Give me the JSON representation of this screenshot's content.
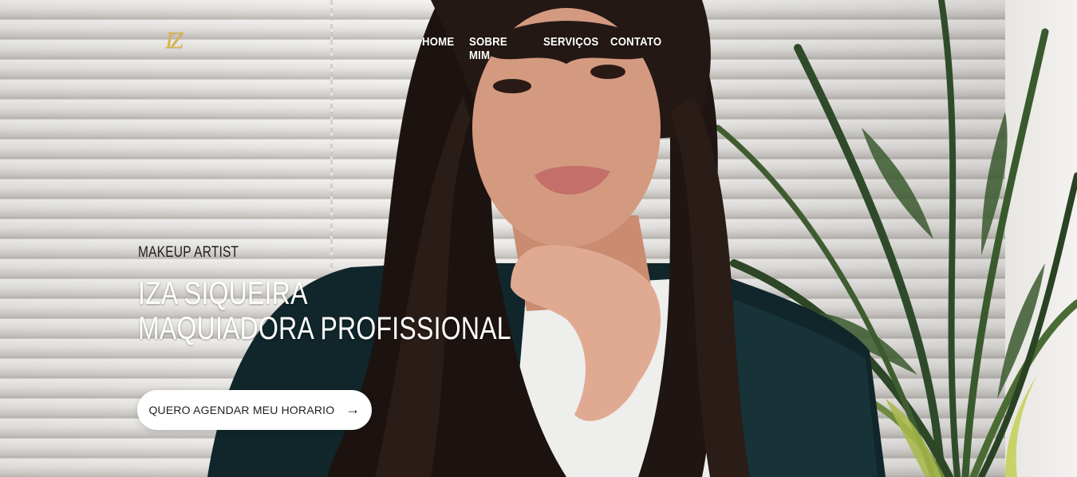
{
  "header": {
    "logo_text": "IZ",
    "nav": [
      {
        "label": "HOME"
      },
      {
        "label": "SOBRE MIM"
      },
      {
        "label": "SERVIÇOS"
      },
      {
        "label": "CONTATO"
      }
    ]
  },
  "hero": {
    "kicker": "MAKEUP ARTIST",
    "headline_line1": "IZA SIQUEIRA",
    "headline_line2": "MAQUIADORA PROFISSIONAL",
    "cta_label": "QUERO AGENDAR MEU HORARIO",
    "cta_icon": "arrow-right-icon"
  },
  "colors": {
    "logo_gold": "#d7b44a",
    "nav_text": "#ffffff",
    "cta_bg": "#ffffff",
    "cta_text": "#222222",
    "kicker_text": "#1e1e1e"
  }
}
